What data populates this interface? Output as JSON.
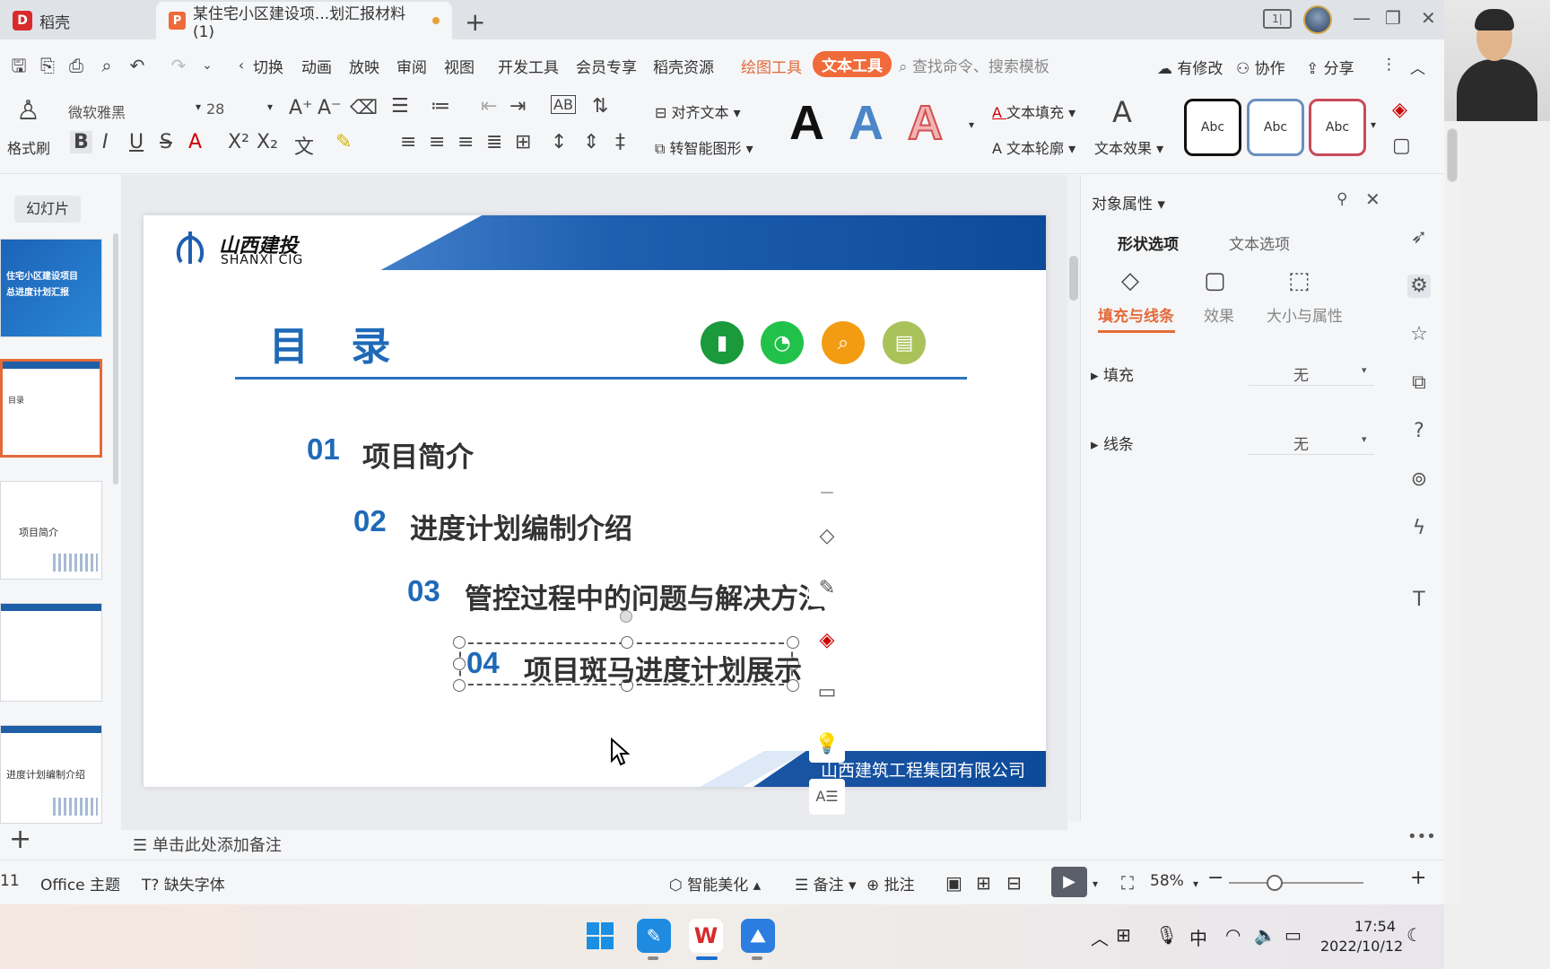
{
  "tabs": {
    "home": "稻壳",
    "doc": "某住宅小区建设项...划汇报材料(1)"
  },
  "menu": {
    "items": [
      "切换",
      "动画",
      "放映",
      "审阅",
      "视图",
      "开发工具",
      "会员专享",
      "稻壳资源"
    ],
    "context1": "绘图工具",
    "context2": "文本工具",
    "search_placeholder": "查找命令、搜索模板",
    "right": [
      "有修改",
      "协作",
      "分享"
    ]
  },
  "ribbon": {
    "format_painter": "格式刷",
    "font_name": "微软雅黑",
    "font_size": "28",
    "align_text": "对齐文本",
    "smart_shape": "转智能图形",
    "text_fill": "文本填充",
    "text_outline": "文本轮廓",
    "text_effect": "文本效果",
    "style_samples": [
      "Abc",
      "Abc",
      "Abc"
    ],
    "colors": {
      "blue": "#1e6ab8",
      "orange": "#e46a3a"
    }
  },
  "slides_panel": {
    "label": "幻灯片",
    "thumbs": [
      {
        "line1": "住宅小区建设项目",
        "line2": "总进度计划汇报"
      },
      {
        "line1": "目录"
      },
      {
        "line1": "项目简介"
      },
      {
        "line1": ""
      },
      {
        "line1": "进度计划编制介绍"
      }
    ]
  },
  "slide": {
    "logo_cn": "山西建投",
    "logo_en": "SHANXI CIG",
    "title": "目 录",
    "items": [
      {
        "num": "01",
        "text": "项目简介"
      },
      {
        "num": "02",
        "text": "进度计划编制介绍"
      },
      {
        "num": "03",
        "text": "管控过程中的问题与解决方法"
      },
      {
        "num": "04",
        "text": "项目斑马进度计划展示"
      }
    ],
    "footer": "山西建筑工程集团有限公司"
  },
  "pane": {
    "title": "对象属性",
    "tabs": [
      "形状选项",
      "文本选项"
    ],
    "subs": [
      "填充与线条",
      "效果",
      "大小与属性"
    ],
    "fill_label": "填充",
    "fill_value": "无",
    "line_label": "线条",
    "line_value": "无"
  },
  "notes": "单击此处添加备注",
  "status": {
    "page": "11",
    "theme": "Office 主题",
    "missing_font": "缺失字体",
    "beautify": "智能美化",
    "notes_btn": "备注",
    "comment": "批注",
    "zoom": "58%"
  },
  "taskbar": {
    "time": "17:54",
    "date": "2022/10/12",
    "ime": "中"
  }
}
